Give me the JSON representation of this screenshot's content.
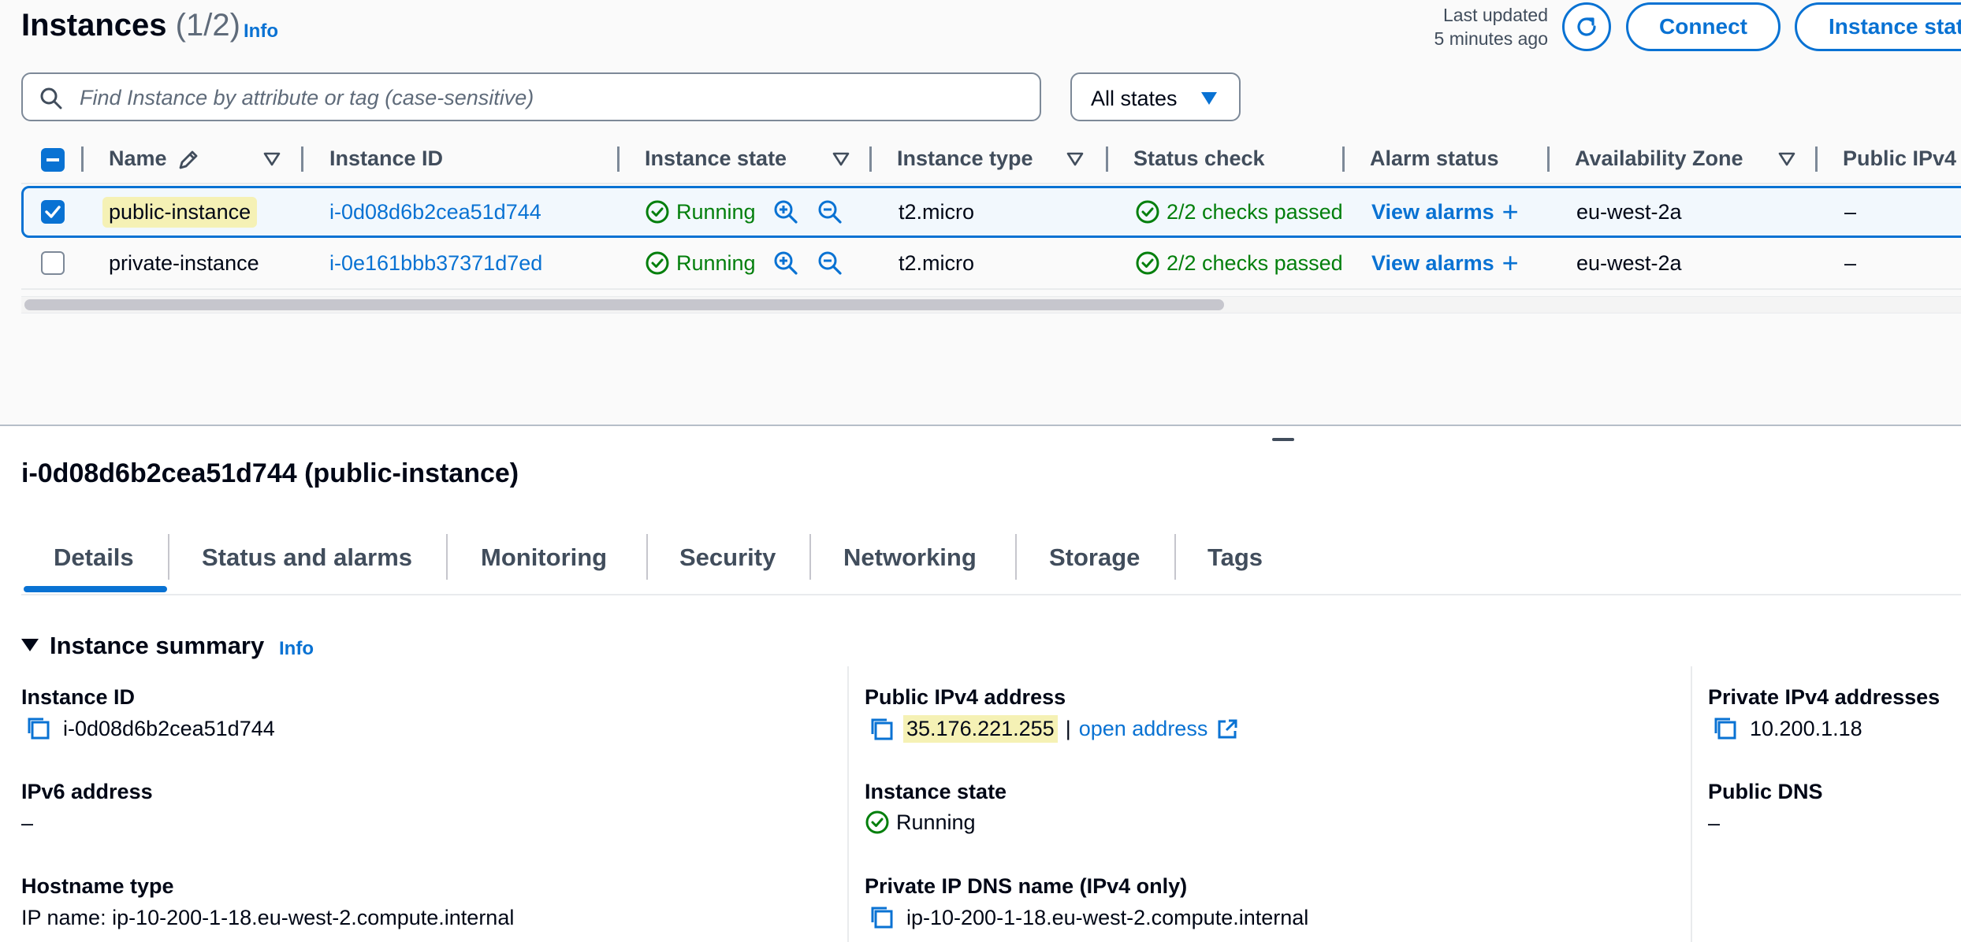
{
  "header": {
    "title": "Instances",
    "count": "(1/2)",
    "info": "Info",
    "last_updated_line1": "Last updated",
    "last_updated_line2": "5 minutes ago",
    "connect_label": "Connect",
    "instance_state_label": "Instance stat"
  },
  "search": {
    "placeholder": "Find Instance by attribute or tag (case-sensitive)"
  },
  "state_filter": {
    "selected": "All states"
  },
  "table": {
    "columns": [
      "Name",
      "Instance ID",
      "Instance state",
      "Instance type",
      "Status check",
      "Alarm status",
      "Availability Zone",
      "Public IPv4"
    ],
    "rows": [
      {
        "selected": true,
        "name": "public-instance",
        "instance_id": "i-0d08d6b2cea51d744",
        "state": "Running",
        "type": "t2.micro",
        "status_check": "2/2 checks passed",
        "alarm": "View alarms",
        "alarm_plus": "+",
        "az": "eu-west-2a",
        "public_ip": "–"
      },
      {
        "selected": false,
        "name": "private-instance",
        "instance_id": "i-0e161bbb37371d7ed",
        "state": "Running",
        "type": "t2.micro",
        "status_check": "2/2 checks passed",
        "alarm": "View alarms",
        "alarm_plus": "+",
        "az": "eu-west-2a",
        "public_ip": "–"
      }
    ]
  },
  "details": {
    "title": "i-0d08d6b2cea51d744 (public-instance)",
    "tabs": [
      "Details",
      "Status and alarms",
      "Monitoring",
      "Security",
      "Networking",
      "Storage",
      "Tags"
    ],
    "active_tab": "Details",
    "summary_title": "Instance summary",
    "summary_info": "Info",
    "fields": {
      "instance_id_label": "Instance ID",
      "instance_id_value": "i-0d08d6b2cea51d744",
      "public_ipv4_label": "Public IPv4 address",
      "public_ipv4_value": "35.176.221.255",
      "public_ipv4_sep": "|",
      "open_address": "open address",
      "private_ipv4_label": "Private IPv4 addresses",
      "private_ipv4_value": "10.200.1.18",
      "ipv6_label": "IPv6 address",
      "ipv6_value": "–",
      "instance_state_label": "Instance state",
      "instance_state_value": "Running",
      "public_dns_label": "Public DNS",
      "public_dns_value": "–",
      "hostname_type_label": "Hostname type",
      "hostname_type_value": "IP name: ip-10-200-1-18.eu-west-2.compute.internal",
      "private_dns_label": "Private IP DNS name (IPv4 only)",
      "private_dns_value": "ip-10-200-1-18.eu-west-2.compute.internal"
    }
  },
  "colors": {
    "link": "#0972d3",
    "success": "#037f0c",
    "highlight": "#f5f1b5",
    "selected_row_bg": "#f2f8fd"
  },
  "icons": [
    "refresh-icon",
    "search-icon",
    "caret-down-icon",
    "edit-pencil-icon",
    "filter-caret-icon",
    "status-success-icon",
    "zoom-in-icon",
    "zoom-out-icon",
    "copy-icon",
    "external-link-icon"
  ]
}
